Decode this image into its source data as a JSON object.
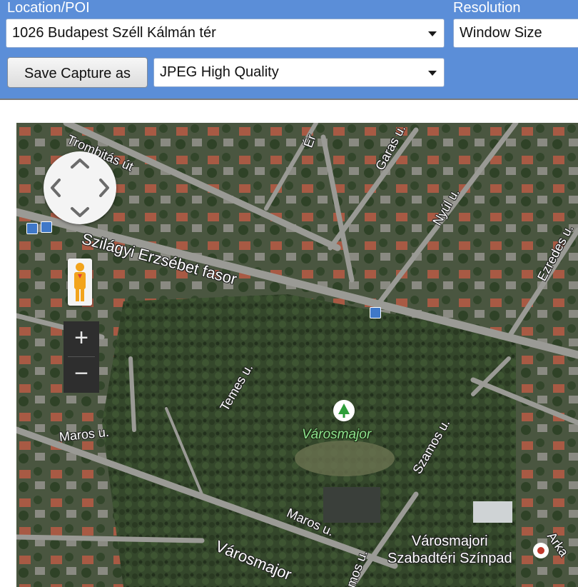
{
  "toolbar": {
    "location_label": "Location/POI",
    "location_value": "1026 Budapest Széll Kálmán tér",
    "resolution_label": "Resolution",
    "resolution_value": "Window Size",
    "save_button": "Save Capture as",
    "format_value": "JPEG High Quality"
  },
  "map": {
    "streets": {
      "trombitas": "Trombitás út",
      "szilagyi": "Szilágyi Erzsébet fasor",
      "garas": "Garas u.",
      "nyul": "Nyúl u.",
      "ezredes": "Ezredes u.",
      "temes": "Temes u.",
      "maros_left": "Maros u.",
      "maros_bottom": "Maros u.",
      "szamos": "Szamos u.",
      "varosmajor_street": "Városmajor",
      "arka": "Arka",
      "er": "Ér",
      "bottom_mos": "mos u."
    },
    "park_name": "Városmajor",
    "poi_line1": "Városmajori",
    "poi_line2": "Szabadtéri Színpad",
    "zoom_in": "+",
    "zoom_out": "−"
  },
  "colors": {
    "toolbar_bg": "#5b8ed8",
    "map_park": "#2f4228",
    "map_roofs": "#b0553a",
    "road": "#9a9a95"
  }
}
